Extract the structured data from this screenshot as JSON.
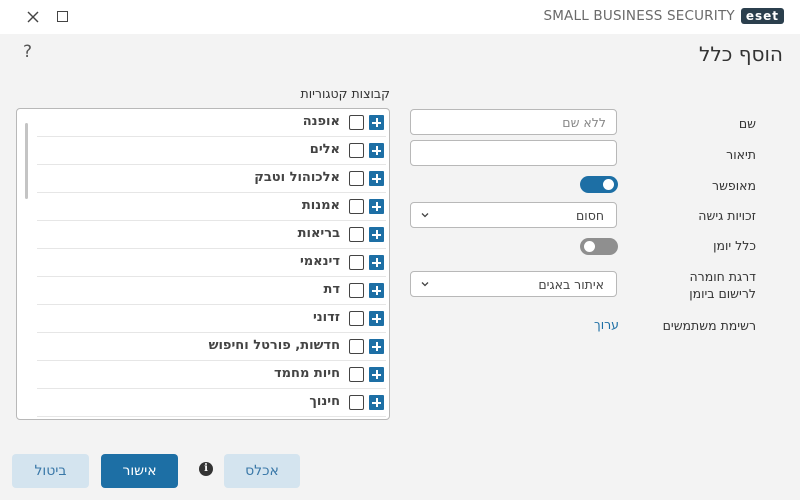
{
  "brand": {
    "logo": "eset",
    "product": "SMALL BUSINESS SECURITY"
  },
  "window_controls": {
    "close_icon": "close-icon",
    "maximize_icon": "maximize-icon"
  },
  "help": "?",
  "page_title": "הוסף כלל",
  "form": {
    "name": {
      "label": "שם",
      "placeholder": "ללא שם"
    },
    "description": {
      "label": "תיאור",
      "value": ""
    },
    "enabled": {
      "label": "מאופשר",
      "state": true
    },
    "access_rights": {
      "label": "זכויות גישה",
      "value": "חסום"
    },
    "log_rule": {
      "label": "כלל יומן",
      "state": false
    },
    "log_severity": {
      "label": "דרגת חומרה לרישום ביומן",
      "value": "איתור באגים"
    },
    "user_list": {
      "label": "רשימת משתמשים",
      "link": "ערוך"
    }
  },
  "categories": {
    "header": "קבוצות קטגוריות",
    "items": [
      "אופנה",
      "אלים",
      "אלכוהול וטבק",
      "אמנות",
      "בריאות",
      "דינאמי",
      "דת",
      "זדוני",
      "חדשות, פורטל וחיפוש",
      "חיות מחמד",
      "חינוך"
    ]
  },
  "buttons": {
    "cancel": "ביטול",
    "ok": "אישור",
    "populate": "אכלס",
    "info": "i"
  },
  "colors": {
    "accent": "#1d6fa5",
    "background": "#f3f3f3",
    "secondary_button": "#d4e4ef"
  }
}
